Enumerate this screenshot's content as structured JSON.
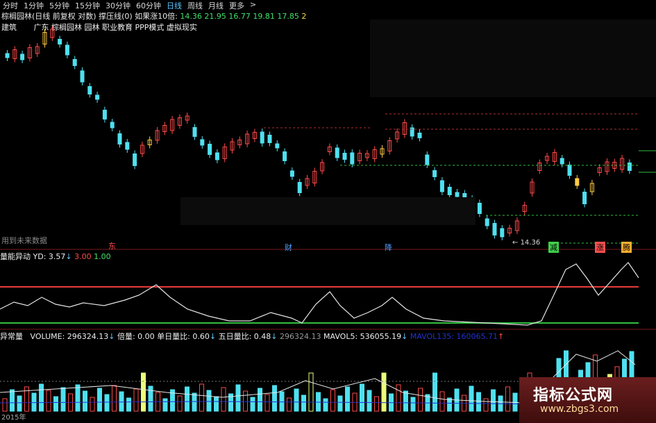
{
  "tabs": [
    "分时",
    "1分钟",
    "5分钟",
    "15分钟",
    "30分钟",
    "60分钟",
    "日线",
    "周线",
    "月线",
    "更多",
    ">"
  ],
  "active_tab": 6,
  "title": {
    "name": "棕榈园林(日线 前复权 对数)",
    "indicator": "撑压线(0)",
    "ifup": "如果涨10倍:",
    "vals": [
      "14.36",
      "21.95",
      "16.77",
      "19.81",
      "17.85",
      "2"
    ]
  },
  "sub": {
    "a": "建筑",
    "b": "广东 棕榈园林 园林 职业教育 PPP模式 虚拟现实"
  },
  "future_note": "用到未来数据",
  "low_label": "14.36",
  "flags": {
    "left": "东",
    "cai": "财",
    "jiang": "降",
    "jian": "减",
    "zhang": "涨",
    "teng": "腾"
  },
  "osc": {
    "title": "量能异动",
    "yd": "YD: 3.57",
    "up_level": "3.00",
    "low_level": "1.00"
  },
  "vol": {
    "title": "异常量",
    "volume": "VOLUME: 296324.13",
    "bei": "倍量: 0.00",
    "dan": "单日量比: 0.60",
    "wu": "五日量比: 0.48",
    "v2": "296324.13",
    "mavol5": "MAVOL5: 536055.19",
    "mavol2": "MAVOL135: 160065.71"
  },
  "year_label": "2015年",
  "watermark": {
    "line1": "指标公式网",
    "line2": "www.zbgs3.com"
  },
  "colors": {
    "up": "#ff4a4a",
    "down": "#4fe0f0",
    "gold": "#ffcc44",
    "osc_red": "#e83a3a",
    "osc_green": "#2fbf3f"
  }
}
